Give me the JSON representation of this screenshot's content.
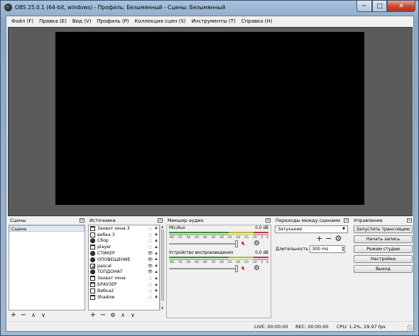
{
  "window": {
    "title": "OBS 25.0.1 (64-bit, windows) - Профиль: Безымянный - Сцены: Безымянный",
    "min": "─",
    "max": "□",
    "close": "✕"
  },
  "menu": [
    "Файл (F)",
    "Правка (E)",
    "Вид (V)",
    "Профиль (P)",
    "Коллекция сцен (S)",
    "Инструменты (T)",
    "Справка (H)"
  ],
  "scenes": {
    "title": "Сцены",
    "items": [
      "Сцена"
    ],
    "toolbar": [
      "+",
      "−",
      "∧",
      "∨"
    ]
  },
  "sources": {
    "title": "Источники",
    "items": [
      {
        "label": "Захват окна 3",
        "icon": "window-icon",
        "visible": false,
        "locked": true
      },
      {
        "label": "вебка 3",
        "icon": "camera-icon",
        "visible": false,
        "locked": true
      },
      {
        "label": "Сбор",
        "icon": "browser-globe-icon",
        "visible": false,
        "locked": true
      },
      {
        "label": "player",
        "icon": "window-icon",
        "visible": false,
        "locked": true
      },
      {
        "label": "СТИКЕР",
        "icon": "browser-globe-icon",
        "visible": true,
        "locked": true
      },
      {
        "label": "ОПОВЕЩЕНИЕ",
        "icon": "browser-globe-icon",
        "visible": true,
        "locked": true
      },
      {
        "label": "pascal",
        "icon": "image-icon",
        "visible": true,
        "locked": true
      },
      {
        "label": "ТОПДОНАТ",
        "icon": "browser-globe-icon",
        "visible": true,
        "locked": true
      },
      {
        "label": "Захват окна",
        "icon": "window-icon",
        "visible": false,
        "locked": true
      },
      {
        "label": "БРАУЗЕР",
        "icon": "window-icon",
        "visible": false,
        "locked": true
      },
      {
        "label": "Вебка2",
        "icon": "camera-icon",
        "visible": false,
        "locked": true
      },
      {
        "label": "Shadow",
        "icon": "window-icon",
        "visible": false,
        "locked": true
      }
    ],
    "toolbar": [
      "+",
      "−",
      "⚙",
      "∧",
      "∨"
    ]
  },
  "mixer": {
    "title": "Микшер аудио",
    "channels": [
      {
        "name": "Mic/Aux",
        "db": "0.0 dB"
      },
      {
        "name": "Устройство воспроизведения",
        "db": "0.0 dB"
      }
    ],
    "scale": [
      "-60",
      "-55",
      "-50",
      "-45",
      "-40",
      "-35",
      "-30",
      "-25",
      "-20",
      "-15",
      "-10",
      "-5",
      "0"
    ]
  },
  "transitions": {
    "title": "Переходы между сценами",
    "selected": "Затухание",
    "tools": [
      "+",
      "−",
      "⚙"
    ],
    "duration_label": "Длительность",
    "duration_value": "300 ms"
  },
  "controls": {
    "title": "Управление",
    "buttons": [
      "Запустить трансляцию",
      "Начать запись",
      "Режим студии",
      "Настройки",
      "Выход"
    ]
  },
  "status": {
    "live": "LIVE: 00:00:00",
    "rec": "REC: 00:00:00",
    "cpu": "CPU: 1.2%, 29.97 fps"
  },
  "colors": {
    "preview_canvas": "#000000",
    "preview_bg": "#5b5b5b",
    "mute_red": "#cc0000"
  }
}
